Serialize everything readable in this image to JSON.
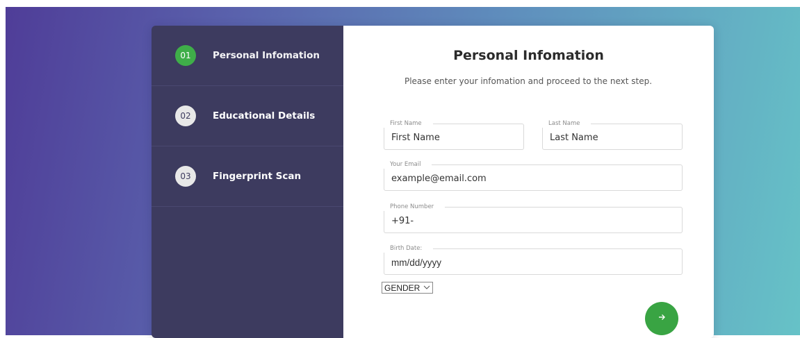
{
  "sidebar": {
    "steps": [
      {
        "number": "01",
        "label": "Personal Infomation",
        "active": true
      },
      {
        "number": "02",
        "label": "Educational Details",
        "active": false
      },
      {
        "number": "03",
        "label": "Fingerprint Scan",
        "active": false
      }
    ]
  },
  "form": {
    "title": "Personal Infomation",
    "subtitle": "Please enter your infomation and proceed to the next step.",
    "first_name": {
      "label": "First Name",
      "placeholder": "First Name"
    },
    "last_name": {
      "label": "Last Name",
      "placeholder": "Last Name"
    },
    "email": {
      "label": "Your Email",
      "placeholder": "example@email.com"
    },
    "phone": {
      "label": "Phone Number",
      "value": "+91-"
    },
    "birth_date": {
      "label": "Birth Date:",
      "placeholder": "mm/dd/yyyy"
    },
    "gender": {
      "selected": "GENDER"
    },
    "next_icon": "arrow-right-icon"
  },
  "colors": {
    "sidebar_bg": "#3d3b5f",
    "active_step": "#3fae49",
    "next_button": "#39a443",
    "gradient_start": "#4f3d98",
    "gradient_end": "#66c2c7"
  }
}
